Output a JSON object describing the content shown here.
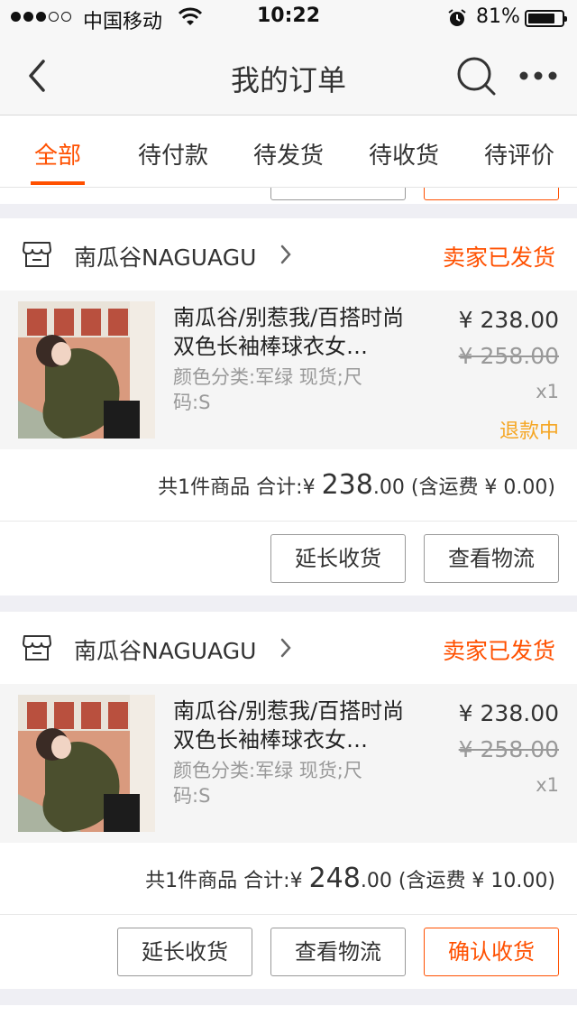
{
  "status_bar": {
    "carrier": "中国移动",
    "time": "10:22",
    "battery": "81%",
    "battery_level": 0.81
  },
  "nav": {
    "title": "我的订单"
  },
  "tabs": [
    {
      "label": "全部",
      "active": true
    },
    {
      "label": "待付款",
      "active": false
    },
    {
      "label": "待发货",
      "active": false
    },
    {
      "label": "待收货",
      "active": false
    },
    {
      "label": "待评价",
      "active": false
    }
  ],
  "orders": [
    {
      "shop_name": "南瓜谷NAGUAGU",
      "status": "卖家已发货",
      "item": {
        "title": "南瓜谷/别惹我/百搭时尚双色长袖棒球衣女…",
        "sku": "颜色分类:军绿 现货;尺码:S",
        "price": "¥ 238.00",
        "original_price": "¥ 258.00",
        "quantity": "x1",
        "refund_status": "退款中"
      },
      "summary": {
        "count_text": "共1件商品",
        "total_label": "合计:",
        "currency": "¥",
        "total_int": "238",
        "total_dec": ".00",
        "shipping_text": "(含运费 ¥ 0.00)"
      },
      "actions": [
        "延长收货",
        "查看物流"
      ]
    },
    {
      "shop_name": "南瓜谷NAGUAGU",
      "status": "卖家已发货",
      "item": {
        "title": "南瓜谷/别惹我/百搭时尚双色长袖棒球衣女…",
        "sku": "颜色分类:军绿 现货;尺码:S",
        "price": "¥ 238.00",
        "original_price": "¥ 258.00",
        "quantity": "x1",
        "refund_status": ""
      },
      "summary": {
        "count_text": "共1件商品",
        "total_label": "合计:",
        "currency": "¥",
        "total_int": "248",
        "total_dec": ".00",
        "shipping_text": "(含运费 ¥ 10.00)"
      },
      "actions": [
        "延长收货",
        "查看物流",
        "确认收货"
      ]
    }
  ],
  "colors": {
    "accent": "#ff5000",
    "refund": "#f5a623"
  }
}
